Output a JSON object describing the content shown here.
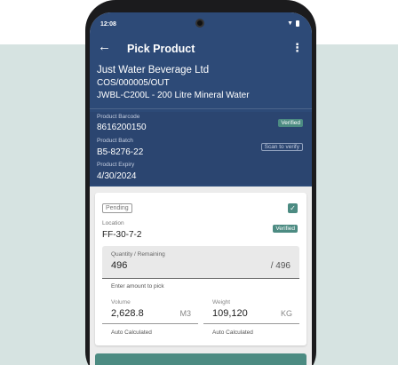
{
  "status_bar": {
    "time": "12:08"
  },
  "app_bar": {
    "title": "Pick Product"
  },
  "order": {
    "customer": "Just Water Beverage Ltd",
    "order_number": "COS/000005/OUT",
    "product": "JWBL-C200L - 200 Litre Mineral Water"
  },
  "product_fields": {
    "barcode_label": "Product Barcode",
    "barcode_value": "8616200150",
    "barcode_status": "Verified",
    "batch_label": "Product Batch",
    "batch_value": "B5-8276-22",
    "batch_status": "Scan to verify",
    "expiry_label": "Product Expiry",
    "expiry_value": "4/30/2024"
  },
  "pick_card": {
    "status": "Pending",
    "location_label": "Location",
    "location_value": "FF-30-7-2",
    "location_status": "Verified",
    "quantity_label": "Quantity / Remaining",
    "quantity_value": "496",
    "quantity_total": "/ 496",
    "quantity_helper": "Enter amount to pick",
    "volume_label": "Volume",
    "volume_value": "2,628.8",
    "volume_unit": "M3",
    "volume_helper": "Auto Calculated",
    "weight_label": "Weight",
    "weight_value": "109,120",
    "weight_unit": "KG",
    "weight_helper": "Auto Calculated"
  },
  "icons": {
    "back": "arrow-left-icon",
    "more": "more-vertical-icon",
    "checkbox": "check-icon",
    "wifi": "wifi-icon",
    "battery": "battery-icon"
  },
  "colors": {
    "header": "#2d4a77",
    "accent": "#4c8b82",
    "backdrop": "#d6e3e1"
  }
}
